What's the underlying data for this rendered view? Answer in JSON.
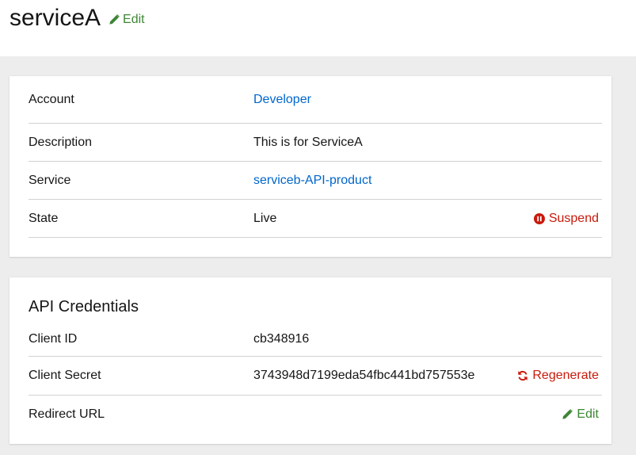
{
  "header": {
    "title": "serviceA",
    "edit_label": "Edit"
  },
  "details": {
    "rows": [
      {
        "label": "Account",
        "value": "Developer"
      },
      {
        "label": "Description",
        "value": "This is for ServiceA"
      },
      {
        "label": "Service",
        "value": "serviceb-API-product"
      },
      {
        "label": "State",
        "value": "Live"
      }
    ],
    "suspend_label": "Suspend"
  },
  "credentials": {
    "title": "API Credentials",
    "rows": [
      {
        "label": "Client ID",
        "value": "cb348916"
      },
      {
        "label": "Client Secret",
        "value": "3743948d7199eda54fbc441bd757553e"
      },
      {
        "label": "Redirect URL",
        "value": ""
      }
    ],
    "regenerate_label": "Regenerate",
    "edit_label": "Edit"
  },
  "colors": {
    "link": "#0066cc",
    "success": "#3e8635",
    "danger": "#c9190b",
    "background": "#ededed"
  }
}
